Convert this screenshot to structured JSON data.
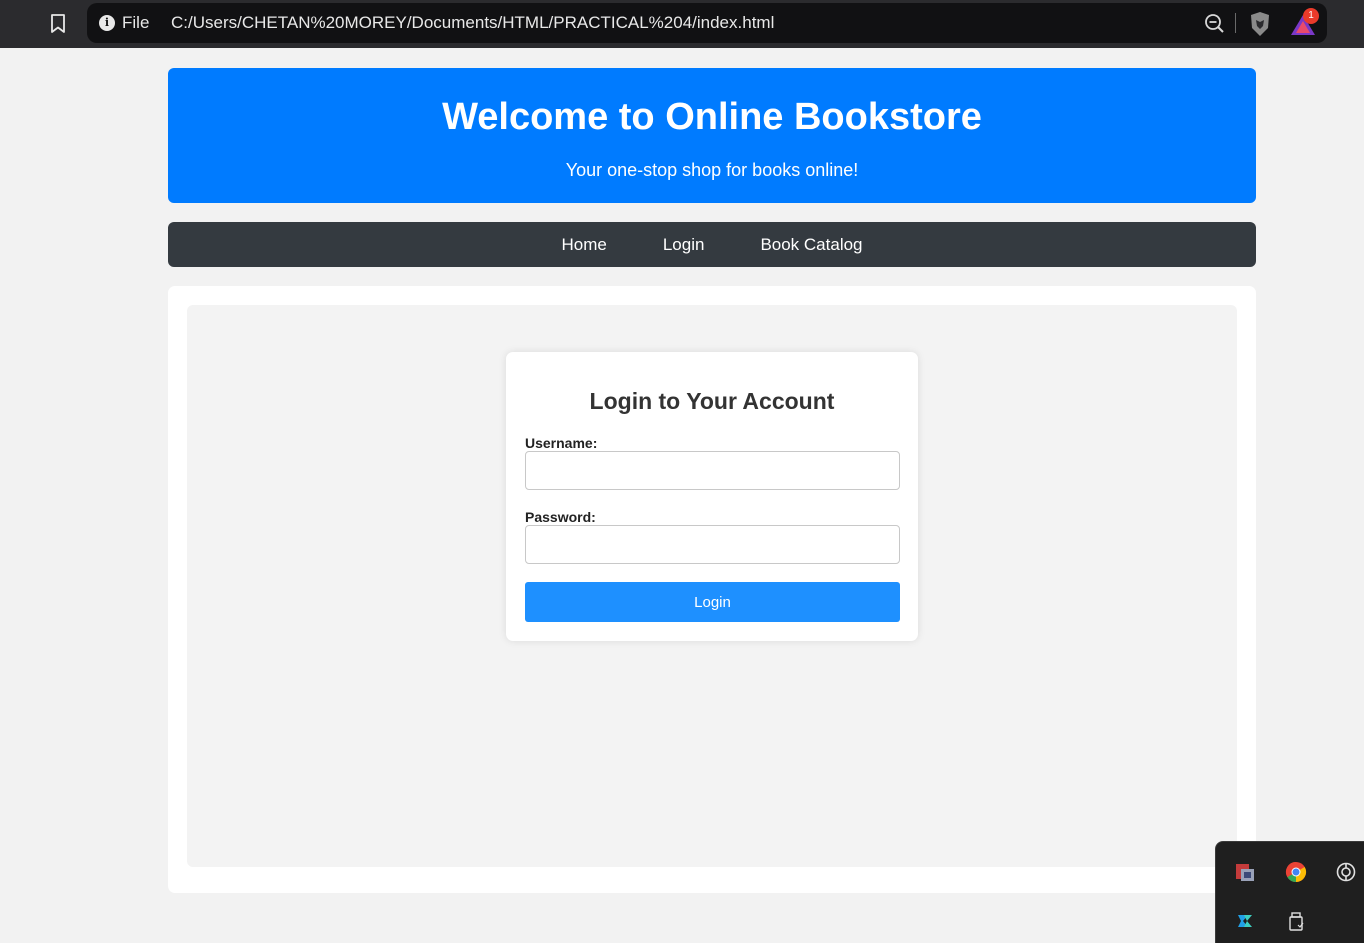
{
  "browser": {
    "file_label": "File",
    "url": "C:/Users/CHETAN%20MOREY/Documents/HTML/PRACTICAL%204/index.html",
    "rewards_count": "1",
    "icons": [
      "bookmark-icon",
      "info-icon",
      "zoom-out-icon",
      "brave-shield-icon",
      "brave-rewards-icon"
    ]
  },
  "header": {
    "title": "Welcome to Online Bookstore",
    "subtitle": "Your one-stop shop for books online!"
  },
  "nav": {
    "items": [
      {
        "label": "Home"
      },
      {
        "label": "Login"
      },
      {
        "label": "Book Catalog"
      }
    ]
  },
  "login": {
    "title": "Login to Your Account",
    "username_label": "Username:",
    "username_value": "",
    "password_label": "Password:",
    "password_value": "",
    "button_label": "Login"
  },
  "tray": {
    "icons": [
      "app-icon",
      "chrome-icon",
      "chatgpt-icon",
      "edge-dev-icon",
      "usb-drive-icon"
    ]
  },
  "colors": {
    "header_bg": "#007bff",
    "nav_bg": "#343a40",
    "button_bg": "#1e90ff",
    "page_bg": "#f2f2f2"
  }
}
